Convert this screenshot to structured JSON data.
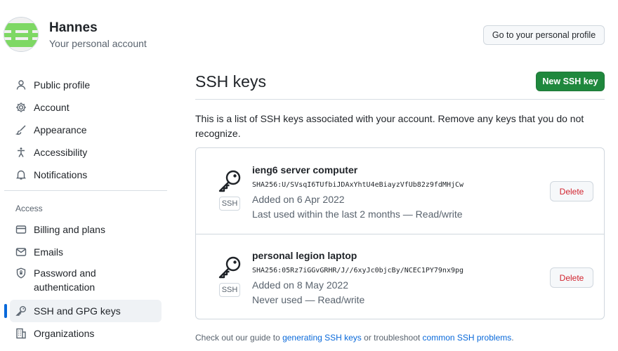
{
  "header": {
    "user_name": "Hannes",
    "user_subtitle": "Your personal account",
    "profile_button": "Go to your personal profile",
    "avatar_colors": {
      "stripe": "#7ed864",
      "background": "#f0f0f0"
    }
  },
  "sidebar": {
    "items": [
      {
        "label": "Public profile",
        "icon": "person-icon"
      },
      {
        "label": "Account",
        "icon": "gear-icon"
      },
      {
        "label": "Appearance",
        "icon": "paintbrush-icon"
      },
      {
        "label": "Accessibility",
        "icon": "accessibility-icon"
      },
      {
        "label": "Notifications",
        "icon": "bell-icon"
      }
    ],
    "access_section_label": "Access",
    "access_items": [
      {
        "label": "Billing and plans",
        "icon": "credit-card-icon"
      },
      {
        "label": "Emails",
        "icon": "mail-icon"
      },
      {
        "label": "Password and authentication",
        "icon": "shield-lock-icon"
      },
      {
        "label": "SSH and GPG keys",
        "icon": "key-icon",
        "active": true
      },
      {
        "label": "Organizations",
        "icon": "organization-icon"
      }
    ]
  },
  "main": {
    "title": "SSH keys",
    "new_key_button": "New SSH key",
    "description": "This is a list of SSH keys associated with your account. Remove any keys that you do not recognize.",
    "keys": [
      {
        "title": "ieng6 server computer",
        "fingerprint": "SHA256:U/SVsqI6TUfbiJDAxYhtU4eBiayzVfUb82z9fdMHjCw",
        "added": "Added on 6 Apr 2022",
        "last_used": "Last used within the last 2 months — Read/write",
        "badge": "SSH",
        "delete_label": "Delete"
      },
      {
        "title": "personal legion laptop",
        "fingerprint": "SHA256:05Rz7iGGvGRHR/J//6xyJc0bjcBy/NCEC1PY79nx9pg",
        "added": "Added on 8 May 2022",
        "last_used": "Never used — Read/write",
        "badge": "SSH",
        "delete_label": "Delete"
      }
    ],
    "footer": {
      "prefix": "Check out our guide to ",
      "link1": "generating SSH keys",
      "middle": " or troubleshoot ",
      "link2": "common SSH problems",
      "suffix": "."
    }
  },
  "colors": {
    "primary_button": "#1f883d",
    "link": "#0969da",
    "danger": "#d1242f",
    "active_indicator": "#0969da"
  }
}
